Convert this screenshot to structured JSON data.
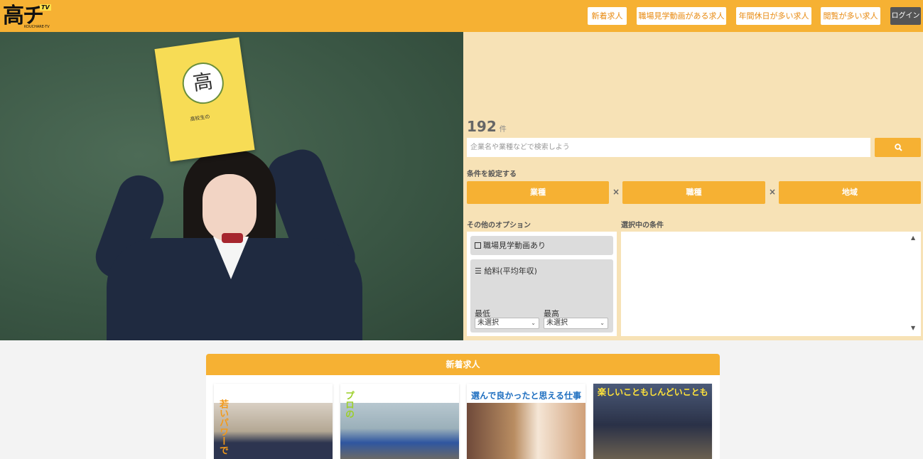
{
  "header": {
    "logo_text": "高チャレ",
    "logo_badge": "TV",
    "logo_sub": "KOUCHARE-TV",
    "nav": [
      {
        "label": "新着求人"
      },
      {
        "label": "職場見学動画がある求人"
      },
      {
        "label": "年間休日が多い求人"
      },
      {
        "label": "閲覧が多い求人"
      }
    ],
    "login_label": "ログイン"
  },
  "hero": {
    "emblem_text": "高",
    "folder_text": "高校生の"
  },
  "search": {
    "count": "192",
    "count_unit": "件",
    "placeholder": "企業名や業種などで検索しよう",
    "conditions_label": "条件を設定する",
    "conditions": [
      {
        "label": "業種"
      },
      {
        "label": "職種"
      },
      {
        "label": "地域"
      }
    ],
    "times_symbol": "×",
    "other_options_label": "その他のオプション",
    "selected_label": "選択中の条件",
    "video_option": "職場見学動画あり",
    "salary_title": "給料(平均年収)",
    "min_label": "最低",
    "max_label": "最高",
    "min_value": "未選択",
    "max_value": "未選択"
  },
  "new_jobs": {
    "title": "新着求人",
    "cards": [
      {
        "caption": "若いパワーで"
      },
      {
        "caption": "プロの"
      },
      {
        "caption": "選んで良かったと思える仕事"
      },
      {
        "caption": "楽しいこともしんどいことも"
      }
    ]
  },
  "colors": {
    "accent": "#f6b133",
    "panel_bg": "#f7e2b6",
    "login_bg": "#555555"
  }
}
